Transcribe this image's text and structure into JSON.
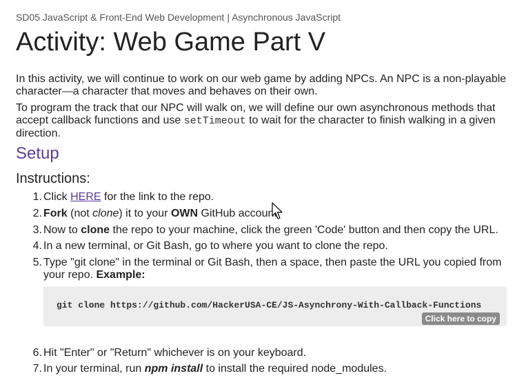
{
  "breadcrumb": "SD05 JavaScript & Front-End Web Development | Asynchronous JavaScript",
  "title": "Activity: Web Game Part V",
  "intro": {
    "p1": "In this activity, we will continue to work on our web game by adding NPCs. An NPC is a non-playable character—a character that moves and behaves on their own.",
    "p2_before": "To program the track that our NPC will walk on, we will define our own asynchronous methods that accept callback functions and use ",
    "p2_code": "setTimeout",
    "p2_after": " to wait for the character to finish walking in a given direction."
  },
  "setup_heading": "Setup",
  "instructions_heading": "Instructions:",
  "steps": {
    "s1": {
      "num": "1.",
      "before": "Click ",
      "link": "HERE",
      "after": " for the link to the repo."
    },
    "s2": {
      "num": "2.",
      "bold1": "Fork",
      "t1": " (not ",
      "em": "clone",
      "t2": ") it to your ",
      "bold2": "OWN",
      "t3": " GitHub account."
    },
    "s3": {
      "num": "3.",
      "t1": "Now to ",
      "bold": "clone",
      "t2": " the repo to your machine, click the green 'Code' button and then copy the URL."
    },
    "s4": {
      "num": "4.",
      "text": "In a new terminal, or Git Bash, go to where you want to clone the repo."
    },
    "s5": {
      "num": "5.",
      "text": "Type \"git clone\" in the terminal or Git Bash, then a space, then paste the URL you copied from your repo. ",
      "bold": "Example:"
    },
    "s6": {
      "num": "6.",
      "text": "Hit \"Enter\" or \"Return\" whichever is on your keyboard."
    },
    "s7": {
      "num": "7.",
      "t1": "In your terminal, run ",
      "em": "npm install",
      "t2": " to install the required node_modules."
    }
  },
  "code_example": "git clone https://github.com/HackerUSA-CE/JS-Asynchrony-With-Callback-Functions",
  "copy_button": "Click here to copy",
  "colors": {
    "accent": "#5b3b9e",
    "code_bg": "#ededed",
    "copy_bg": "#8a8a8a"
  }
}
